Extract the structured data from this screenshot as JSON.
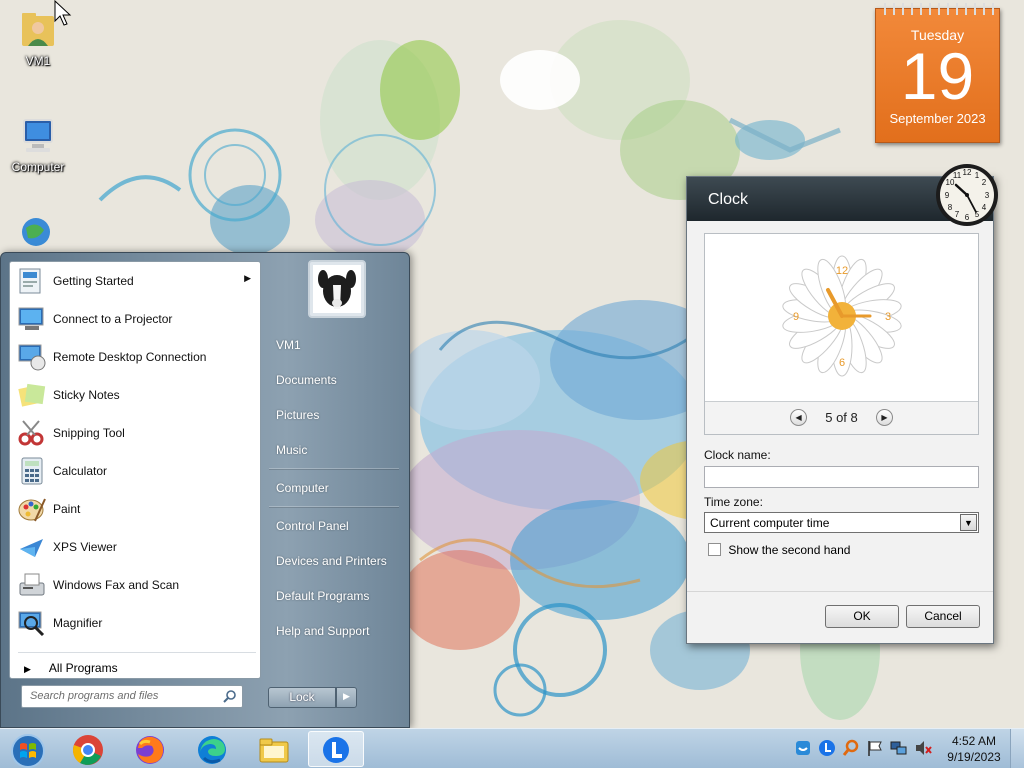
{
  "desktop": {
    "icons": [
      {
        "label": "VM1",
        "icon": "user-folder-icon"
      },
      {
        "label": "Computer",
        "icon": "computer-icon"
      },
      {
        "label": "",
        "icon": "network-icon"
      }
    ]
  },
  "calendar_gadget": {
    "weekday": "Tuesday",
    "day": "19",
    "month_year": "September 2023",
    "accent": "#e8761f"
  },
  "clock_dialog": {
    "title": "Clock",
    "pager": "5 of 8",
    "clock_name_label": "Clock name:",
    "clock_name_value": "",
    "time_zone_label": "Time zone:",
    "time_zone_value": "Current computer time",
    "second_hand_label": "Show the second hand",
    "second_hand_checked": false,
    "ok_label": "OK",
    "cancel_label": "Cancel"
  },
  "start_menu": {
    "programs": [
      {
        "label": "Getting Started",
        "icon": "getting-started-icon",
        "submenu": true
      },
      {
        "label": "Connect to a Projector",
        "icon": "projector-icon",
        "submenu": false
      },
      {
        "label": "Remote Desktop Connection",
        "icon": "remote-desktop-icon",
        "submenu": false
      },
      {
        "label": "Sticky Notes",
        "icon": "sticky-notes-icon",
        "submenu": false
      },
      {
        "label": "Snipping Tool",
        "icon": "snipping-tool-icon",
        "submenu": false
      },
      {
        "label": "Calculator",
        "icon": "calculator-icon",
        "submenu": false
      },
      {
        "label": "Paint",
        "icon": "paint-icon",
        "submenu": false
      },
      {
        "label": "XPS Viewer",
        "icon": "xps-viewer-icon",
        "submenu": false
      },
      {
        "label": "Windows Fax and Scan",
        "icon": "fax-scan-icon",
        "submenu": false
      },
      {
        "label": "Magnifier",
        "icon": "magnifier-icon",
        "submenu": false
      }
    ],
    "all_programs": "All Programs",
    "search_placeholder": "Search programs and files",
    "right_items": [
      "VM1",
      "Documents",
      "Pictures",
      "Music",
      "Computer",
      "Control Panel",
      "Devices and Printers",
      "Default Programs",
      "Help and Support"
    ],
    "power_button": "Lock"
  },
  "taskbar": {
    "buttons": [
      {
        "icon": "start-orb-icon"
      },
      {
        "icon": "chrome-icon"
      },
      {
        "icon": "firefox-icon"
      },
      {
        "icon": "edge-icon"
      },
      {
        "icon": "file-explorer-icon"
      },
      {
        "icon": "app-l-icon",
        "active": true
      }
    ],
    "tray_icons": [
      "shield-tray-icon",
      "app-l-tray-icon",
      "search-tray-icon",
      "flag-tray-icon",
      "network-tray-icon",
      "volume-muted-icon"
    ],
    "time": "4:52 AM",
    "date": "9/19/2023"
  }
}
